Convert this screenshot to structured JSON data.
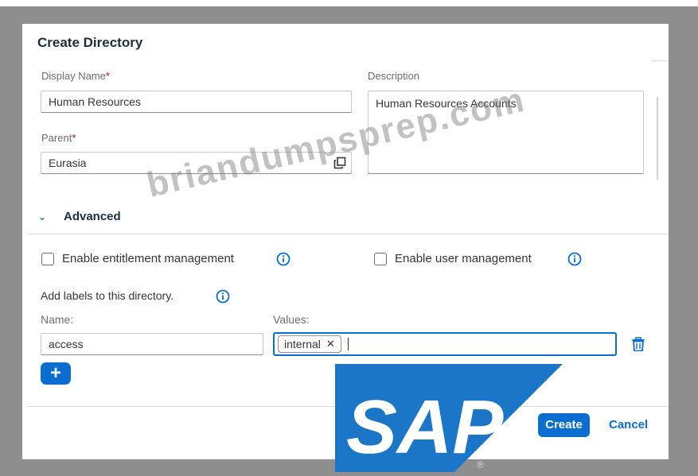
{
  "dialog": {
    "title": "Create Directory",
    "display_name": {
      "label": "Display Name",
      "required_mark": "*",
      "value": "Human Resources"
    },
    "description": {
      "label": "Description",
      "value": "Human Resources Accounts"
    },
    "parent": {
      "label": "Parent",
      "required_mark": "*",
      "value": "Eurasia"
    },
    "advanced": {
      "label": "Advanced",
      "expanded": true
    },
    "enable_entitlement": {
      "label": "Enable entitlement management",
      "checked": false
    },
    "enable_user_mgmt": {
      "label": "Enable user management",
      "checked": false
    },
    "labels_section": {
      "title": "Add labels to this directory.",
      "name_header": "Name:",
      "values_header": "Values:"
    },
    "label_row": {
      "name": "access",
      "tokens": [
        "internal"
      ]
    },
    "buttons": {
      "create": "Create",
      "cancel": "Cancel",
      "add": "+"
    }
  },
  "watermark": "briandumpsprep.com",
  "logo": {
    "text": "SAP",
    "reg": "®"
  },
  "colors": {
    "accent": "#0a6ed1",
    "required": "#bb0000",
    "logo_blue": "#1b76c7"
  }
}
